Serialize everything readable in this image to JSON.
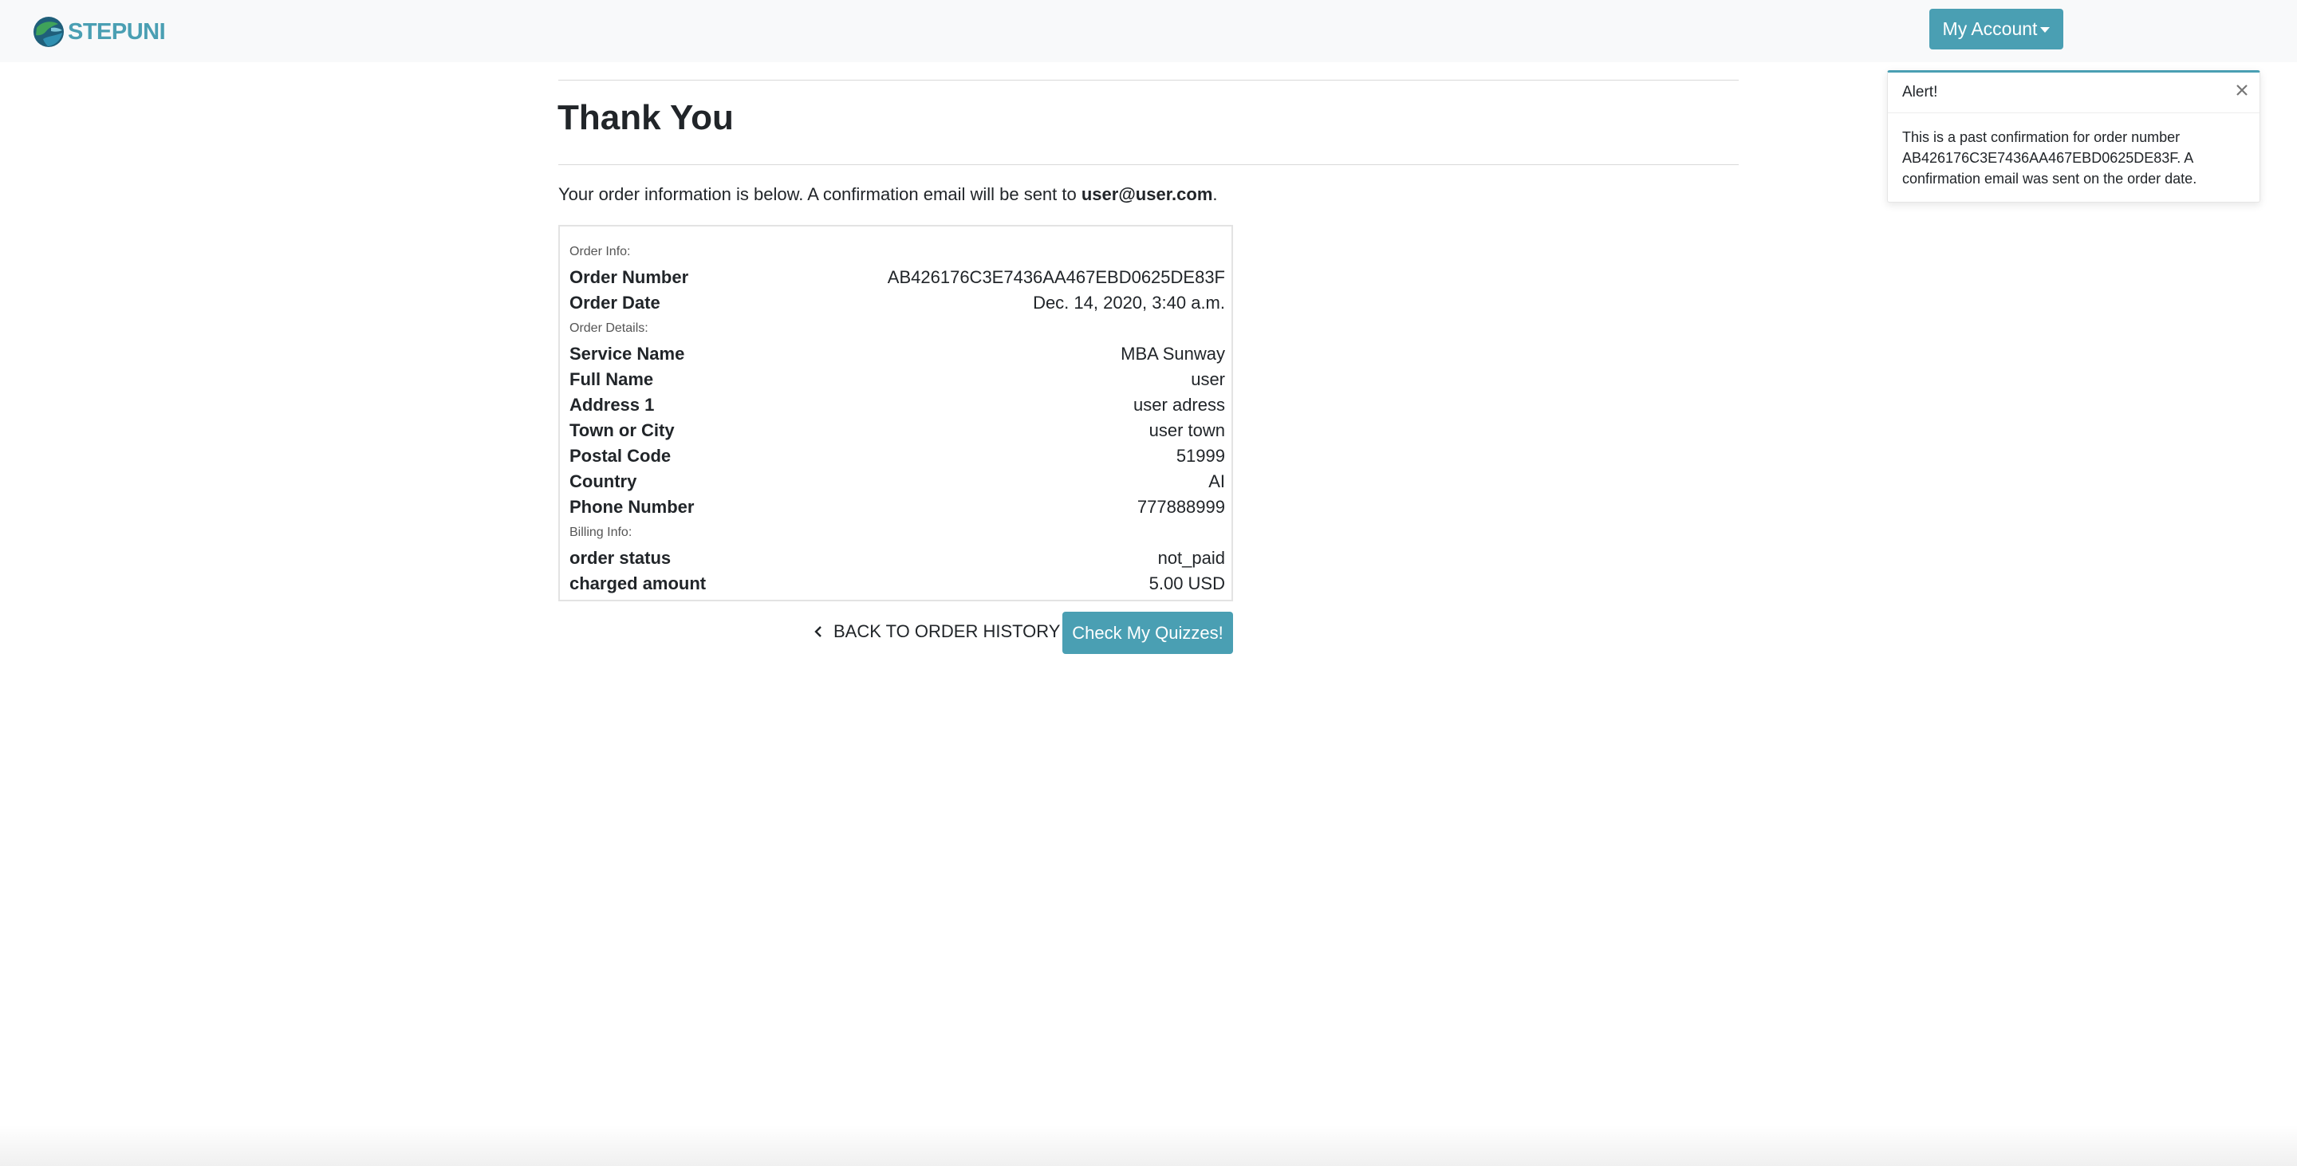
{
  "header": {
    "brand_name": "STEPUNI",
    "account_button_label": "My Account",
    "colors": {
      "accent": "#4a9fb3",
      "navbar_bg": "#f8f9fa"
    }
  },
  "main": {
    "title": "Thank You",
    "intro_prefix": "Your order information is below. A confirmation email will be sent to ",
    "intro_email": "user@user.com",
    "intro_suffix": ".",
    "order_info_label": "Order Info:",
    "order_info": [
      {
        "label": "Order Number",
        "value": "AB426176C3E7436AA467EBD0625DE83F"
      },
      {
        "label": "Order Date",
        "value": "Dec. 14, 2020, 3:40 a.m."
      }
    ],
    "order_details_label": "Order Details:",
    "order_details": [
      {
        "label": "Service Name",
        "value": "MBA Sunway"
      },
      {
        "label": "Full Name",
        "value": "user"
      },
      {
        "label": "Address 1",
        "value": "user adress"
      },
      {
        "label": "Town or City",
        "value": "user town"
      },
      {
        "label": "Postal Code",
        "value": "51999"
      },
      {
        "label": "Country",
        "value": "AI"
      },
      {
        "label": "Phone Number",
        "value": "777888999"
      }
    ],
    "billing_info_label": "Billing Info:",
    "billing_info": [
      {
        "label": "order status",
        "value": "not_paid"
      },
      {
        "label": "charged amount",
        "value": "5.00 USD"
      }
    ],
    "back_link_label": "BACK TO ORDER HISTORY",
    "quiz_button_label": "Check My Quizzes!"
  },
  "alert": {
    "title": "Alert!",
    "body": "This is a past confirmation for order number AB426176C3E7436AA467EBD0625DE83F. A confirmation email was sent on the order date.",
    "close_icon": "close-icon"
  },
  "icons": {
    "brand": "globe-logo-icon",
    "account_caret": "caret-down-icon",
    "back": "chevron-left-icon"
  }
}
